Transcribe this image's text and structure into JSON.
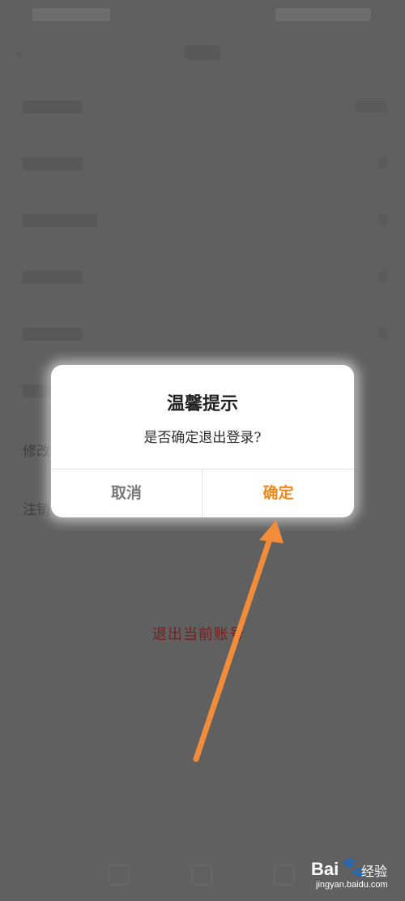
{
  "dialog": {
    "title": "温馨提示",
    "message": "是否确定退出登录?",
    "cancel_label": "取消",
    "confirm_label": "确定"
  },
  "background_rows": {
    "row_7_prefix": "修改",
    "row_8_prefix": "注销"
  },
  "annotation": {
    "text": "退出当前账号"
  },
  "watermark": {
    "logo": "Bai",
    "logo_suffix": "经验",
    "url": "jingyan.baidu.com"
  },
  "colors": {
    "overlay": "#606060",
    "confirm": "#ee8a1a",
    "cancel": "#7a7a7a",
    "arrow": "#f08c3a",
    "annotation": "#7a1d1d"
  },
  "icons": {
    "back": "chevron-left-icon",
    "paw": "paw-icon"
  }
}
